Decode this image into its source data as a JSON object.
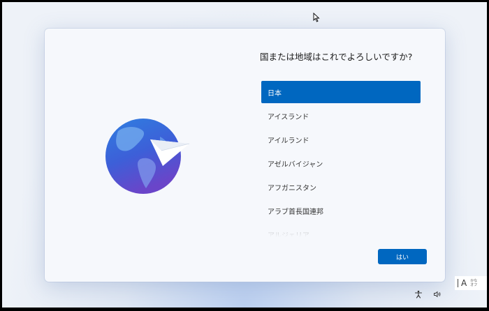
{
  "setup": {
    "question": "国または地域はこれでよろしいですか?",
    "countries": [
      {
        "label": "日本",
        "selected": true
      },
      {
        "label": "アイスランド",
        "selected": false
      },
      {
        "label": "アイルランド",
        "selected": false
      },
      {
        "label": "アゼルバイジャン",
        "selected": false
      },
      {
        "label": "アフガニスタン",
        "selected": false
      },
      {
        "label": "アラブ首長国連邦",
        "selected": false
      },
      {
        "label": "アルジェリア",
        "selected": false
      }
    ],
    "yes_button_label": "はい"
  },
  "taskbar": {
    "ime_mode": "A",
    "ime_kana_line1": "かな",
    "ime_kana_line2": "オフ"
  },
  "colors": {
    "accent": "#0067c0"
  }
}
